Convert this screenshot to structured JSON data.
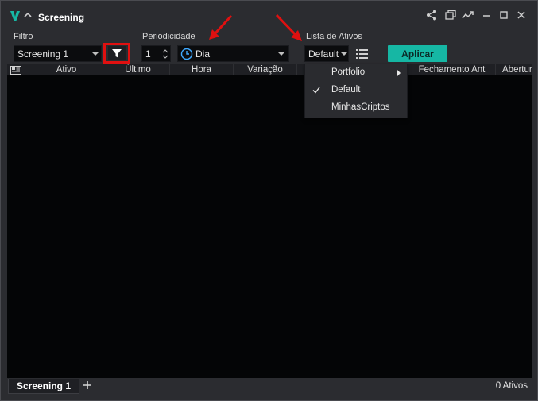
{
  "window": {
    "title": "Screening"
  },
  "toolbar": {
    "filtro_label": "Filtro",
    "filtro_value": "Screening 1",
    "periodicidade_label": "Periodicidade",
    "period_number": "1",
    "period_unit": "Dia",
    "lista_label": "Lista de Ativos",
    "lista_value": "Default",
    "aplicar_label": "Aplicar"
  },
  "grid": {
    "columns": [
      "Ativo",
      "Último",
      "Hora",
      "Variação",
      "Fechamento Ant",
      "Abertura"
    ],
    "rows": []
  },
  "menu": {
    "items": [
      {
        "label": "Portfolio",
        "has_submenu": true,
        "checked": false
      },
      {
        "label": "Default",
        "has_submenu": false,
        "checked": true
      },
      {
        "label": "MinhasCriptos",
        "has_submenu": false,
        "checked": false
      }
    ]
  },
  "bottom": {
    "tab_label": "Screening 1",
    "status": "0 Ativos"
  },
  "colors": {
    "accent": "#16b7a4",
    "highlight_red": "#e01010",
    "background": "#2b2c30",
    "grid_bg": "#040506"
  },
  "icons": [
    "logo-v-icon",
    "collapse-icon",
    "share-icon",
    "popout-icon",
    "chart-trend-icon",
    "minimize-icon",
    "maximize-icon",
    "close-icon",
    "filter-icon",
    "clock-icon",
    "list-icon",
    "grid-settings-icon",
    "submenu-arrow-icon",
    "check-icon",
    "add-tab-icon"
  ]
}
